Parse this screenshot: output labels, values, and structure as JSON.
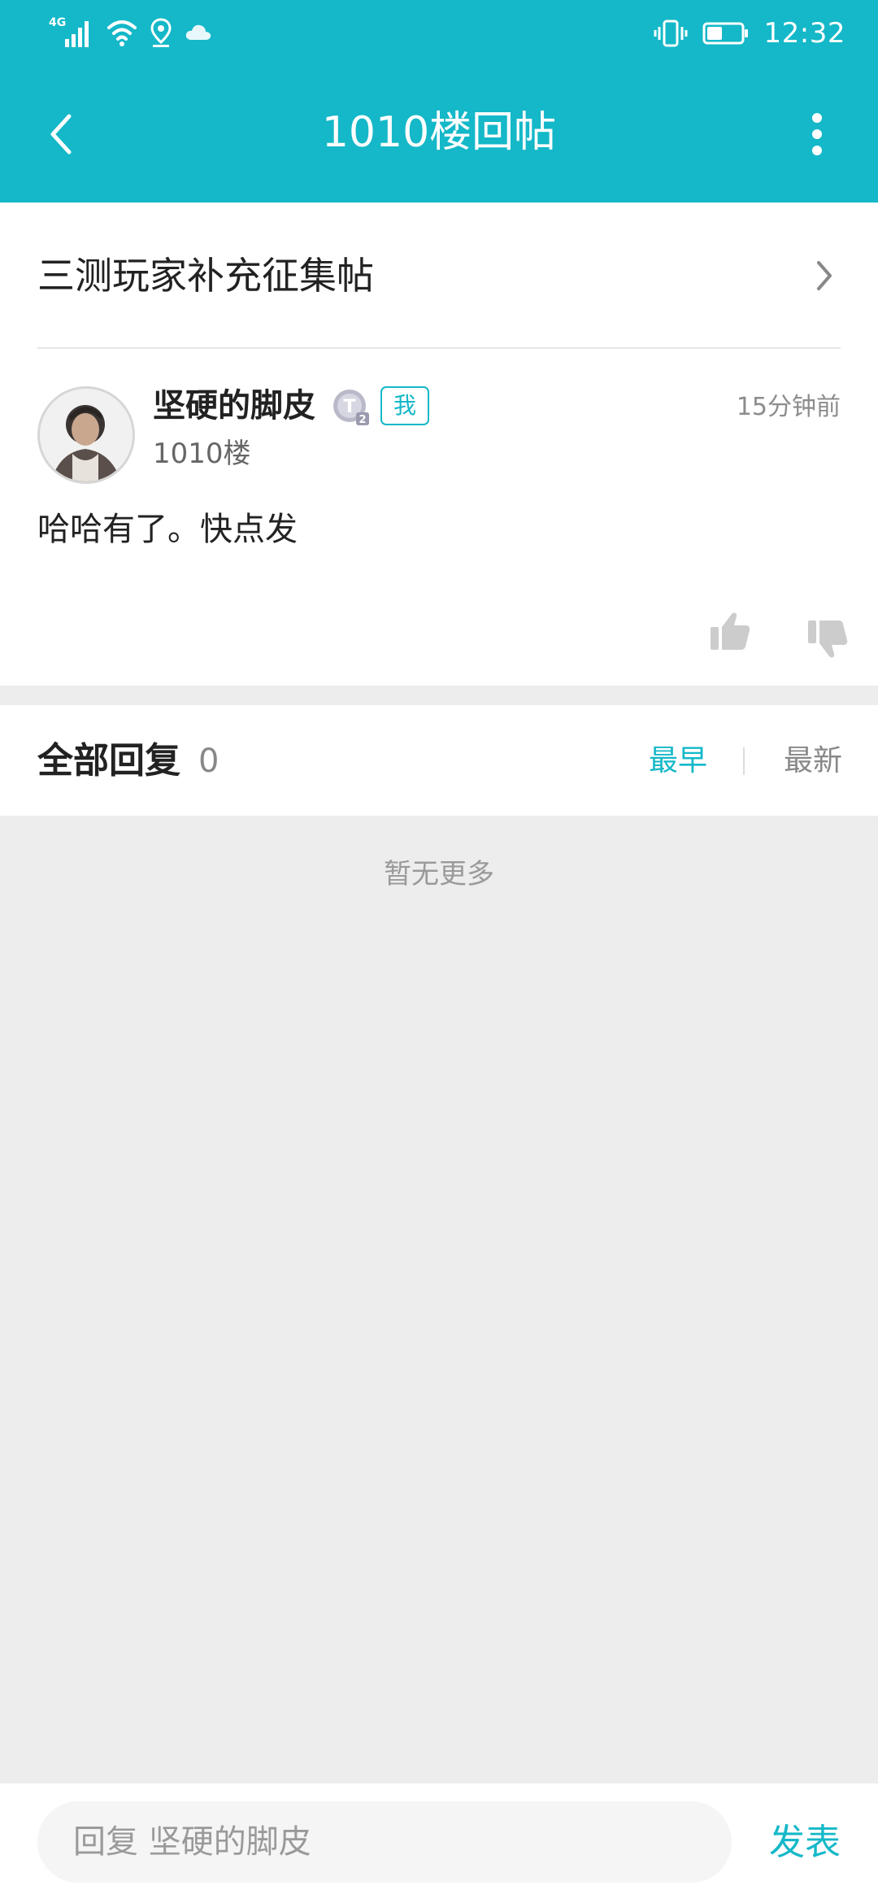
{
  "status_bar": {
    "network_label": "4G",
    "time": "12:32"
  },
  "app_bar": {
    "title": "1010楼回帖"
  },
  "thread": {
    "title": "三测玩家补充征集帖"
  },
  "post": {
    "author": "坚硬的脚皮",
    "level_badge_letter": "T",
    "level_badge_number": "2",
    "me_tag": "我",
    "time": "15分钟前",
    "floor": "1010楼",
    "content": "哈哈有了。快点发"
  },
  "replies": {
    "title": "全部回复",
    "count": "0",
    "sort_earliest": "最早",
    "sort_latest": "最新",
    "selected_sort": "最早",
    "empty_text": "暂无更多"
  },
  "reply_bar": {
    "placeholder": "回复 坚硬的脚皮",
    "send_label": "发表"
  },
  "colors": {
    "accent": "#14b8c8",
    "page_background": "#ededed"
  }
}
